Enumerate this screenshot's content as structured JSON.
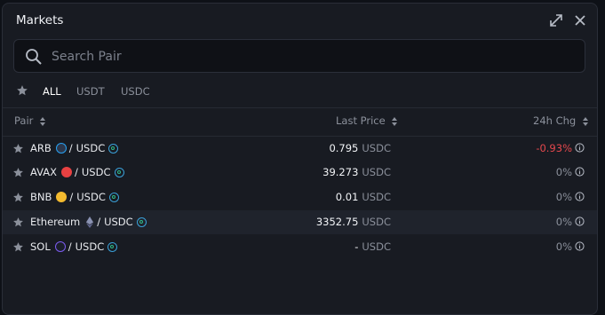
{
  "window": {
    "title": "Markets"
  },
  "search": {
    "placeholder": "Search Pair",
    "value": ""
  },
  "filters": {
    "tabs": [
      "ALL",
      "USDT",
      "USDC"
    ],
    "active": "ALL"
  },
  "columns": {
    "pair": "Pair",
    "last_price": "Last Price",
    "change": "24h Chg"
  },
  "rows": [
    {
      "base": "ARB",
      "base_icon": "arbitrum-icon",
      "quote": "USDC",
      "price": "0.795",
      "unit": "USDC",
      "change": "-0.93%"
    },
    {
      "base": "AVAX",
      "base_icon": "avalanche-icon",
      "quote": "USDC",
      "price": "39.273",
      "unit": "USDC",
      "change": "0%"
    },
    {
      "base": "BNB",
      "base_icon": "bnb-icon",
      "quote": "USDC",
      "price": "0.01",
      "unit": "USDC",
      "change": "0%"
    },
    {
      "base": "Ethereum",
      "base_icon": "ethereum-icon",
      "quote": "USDC",
      "price": "3352.75",
      "unit": "USDC",
      "change": "0%"
    },
    {
      "base": "SOL",
      "base_icon": "solana-icon",
      "quote": "USDC",
      "price": "-",
      "unit": "USDC",
      "change": "0%"
    }
  ],
  "colors": {
    "negative": "#e5484d",
    "neutral": "#8b909b",
    "panel": "#181b22",
    "highlight_row": "#1f232c"
  }
}
